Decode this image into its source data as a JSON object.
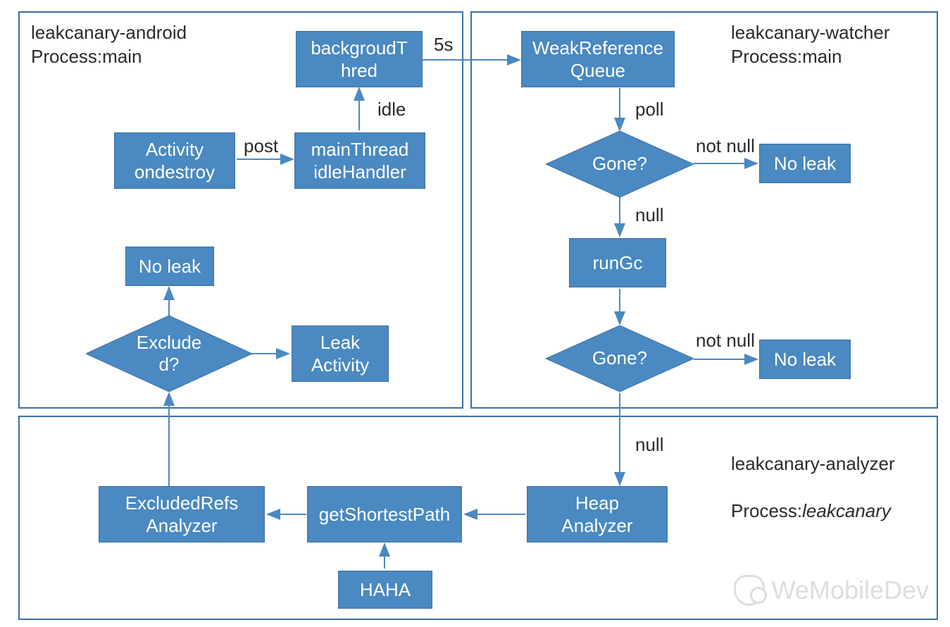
{
  "containers": {
    "android": {
      "title": "leakcanary-android\nProcess:main"
    },
    "watcher": {
      "title": "leakcanary-watcher\nProcess:main"
    },
    "analyzer": {
      "title": "leakcanary-analyzer",
      "process": "Process:",
      "process_name": "leakcanary"
    }
  },
  "boxes": {
    "activity_ondestroy": "Activity\nondestroy",
    "mainthread_idlehandler": "mainThread\nidleHandler",
    "background_thread": "backgroudT\nhred",
    "weakref_queue": "WeakReference\nQueue",
    "no_leak_1": "No leak",
    "runGc": "runGc",
    "no_leak_2": "No leak",
    "no_leak_3": "No leak",
    "leak_activity": "Leak\nActivity",
    "heap_analyzer": "Heap\nAnalyzer",
    "get_shortest_path": "getShortestPath",
    "haha": "HAHA",
    "excluded_refs_analyzer": "ExcludedRefs\nAnalyzer"
  },
  "diamonds": {
    "gone_1": "Gone?",
    "gone_2": "Gone?",
    "excluded": "Exclude\nd?"
  },
  "edges": {
    "post": "post",
    "idle": "idle",
    "delay5s": "5s",
    "poll": "poll",
    "not_null_1": "not null",
    "null_1": "null",
    "not_null_2": "not null",
    "null_2": "null"
  },
  "watermark": "WeMobileDev"
}
